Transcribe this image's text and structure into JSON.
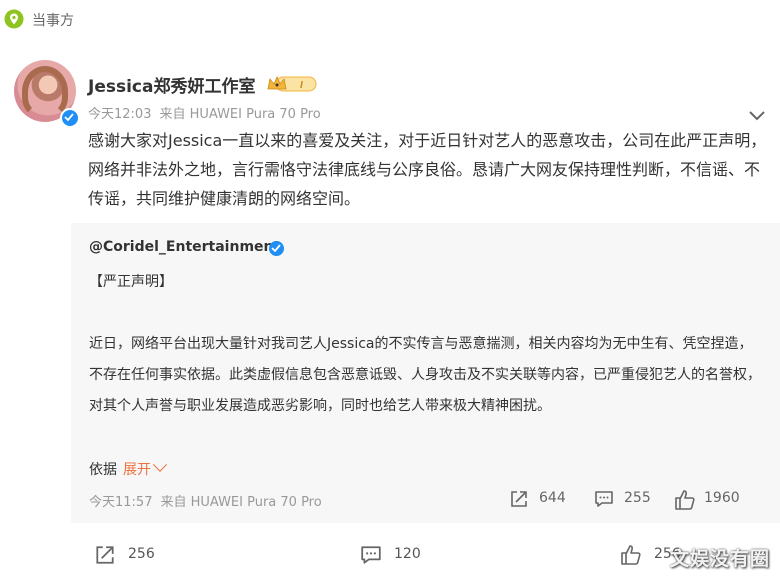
{
  "topbar": {
    "party_label": "当事方",
    "icon": "location-pin-icon"
  },
  "post": {
    "username": "Jessica郑秀妍工作室",
    "time": "今天12:03",
    "source": "来自 HUAWEI Pura 70 Pro",
    "text": "感谢大家对Jessica一直以来的喜爱及关注，对于近日针对艺人的恶意攻击，公司在此严正声明，网络并非法外之地，言行需恪守法律底线与公序良俗。恳请广大网友保持理性判断，不信谣、不传谣，共同维护健康清朗的网络空间。"
  },
  "repost": {
    "username": "@Coridel_Entertainment",
    "title": "【严正声明】",
    "body": "近日，网络平台出现大量针对我司艺人Jessica的不实传言与恶意揣测，相关内容均为无中生有、凭空捏造，不存在任何事实依据。此类虚假信息包含恶意诋毁、人身攻击及不实关联等内容，已严重侵犯艺人的名誉权，对其个人声誉与职业发展造成恶劣影响，同时也给艺人带来极大精神困扰。",
    "basis_label": "依据",
    "expand_label": "展开",
    "time": "今天11:57",
    "source": "来自 HUAWEI Pura 70 Pro",
    "stats": {
      "reposts": "644",
      "comments": "255",
      "likes": "1960"
    }
  },
  "actions": {
    "reposts": "256",
    "comments": "120",
    "likes": "256"
  },
  "watermark": "文娱没有圈",
  "colors": {
    "accent": "#eb7340",
    "verified": "#1f8ff6",
    "badge_gold": "#f2b53a"
  }
}
